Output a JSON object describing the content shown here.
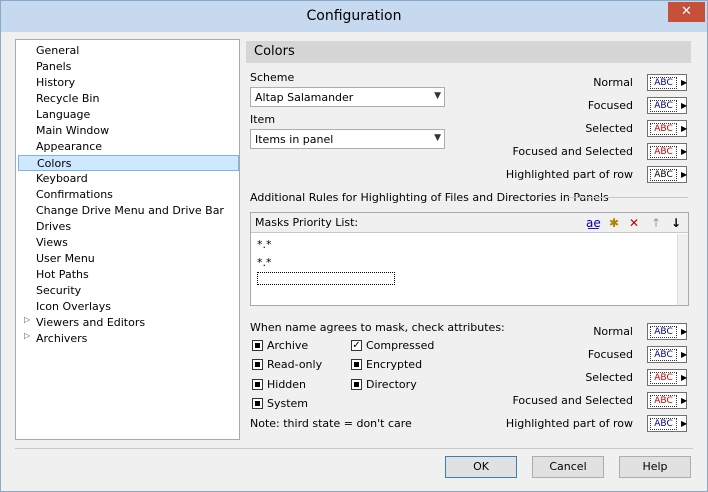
{
  "window": {
    "title": "Configuration",
    "close_glyph": "✕"
  },
  "tree": {
    "items": [
      {
        "label": "General"
      },
      {
        "label": "Panels"
      },
      {
        "label": "History"
      },
      {
        "label": "Recycle Bin"
      },
      {
        "label": "Language"
      },
      {
        "label": "Main Window"
      },
      {
        "label": "Appearance"
      },
      {
        "label": "Colors"
      },
      {
        "label": "Keyboard"
      },
      {
        "label": "Confirmations"
      },
      {
        "label": "Change Drive Menu and Drive Bar"
      },
      {
        "label": "Drives"
      },
      {
        "label": "Views"
      },
      {
        "label": "User Menu"
      },
      {
        "label": "Hot Paths"
      },
      {
        "label": "Security"
      },
      {
        "label": "Icon Overlays"
      },
      {
        "label": "Viewers and Editors"
      },
      {
        "label": "Archivers"
      }
    ],
    "selected": "Colors",
    "expandable": [
      "Viewers and Editors",
      "Archivers"
    ]
  },
  "panel": {
    "header": "Colors",
    "scheme_label": "Scheme",
    "scheme_value": "Altap Salamander",
    "item_label": "Item",
    "item_value": "Items in panel",
    "abc": "ABC",
    "colors_top": [
      {
        "label": "Normal",
        "color": "#000080"
      },
      {
        "label": "Focused",
        "color": "#000080"
      },
      {
        "label": "Selected",
        "color": "#cc0000"
      },
      {
        "label": "Focused and Selected",
        "color": "#cc0000"
      },
      {
        "label": "Highlighted part of row",
        "color": "#000000"
      }
    ],
    "rules_title": "Additional Rules for Highlighting of Files and Directories in Panels",
    "masks_label": "Masks Priority List:",
    "masks": [
      "*.*",
      "*.*"
    ],
    "attr_label": "When name agrees to mask, check attributes:",
    "attributes": [
      {
        "label": "Archive",
        "state": "indeterminate"
      },
      {
        "label": "Read-only",
        "state": "indeterminate"
      },
      {
        "label": "Hidden",
        "state": "indeterminate"
      },
      {
        "label": "System",
        "state": "indeterminate"
      },
      {
        "label": "Compressed",
        "state": "checked"
      },
      {
        "label": "Encrypted",
        "state": "indeterminate"
      },
      {
        "label": "Directory",
        "state": "indeterminate"
      }
    ],
    "note": "Note: third state = don't care",
    "colors_bottom": [
      {
        "label": "Normal",
        "color": "#000080"
      },
      {
        "label": "Focused",
        "color": "#000080"
      },
      {
        "label": "Selected",
        "color": "#cc0000"
      },
      {
        "label": "Focused and Selected",
        "color": "#cc0000"
      },
      {
        "label": "Highlighted part of row",
        "color": "#000080"
      }
    ]
  },
  "buttons": {
    "ok": "OK",
    "cancel": "Cancel",
    "help": "Help"
  }
}
